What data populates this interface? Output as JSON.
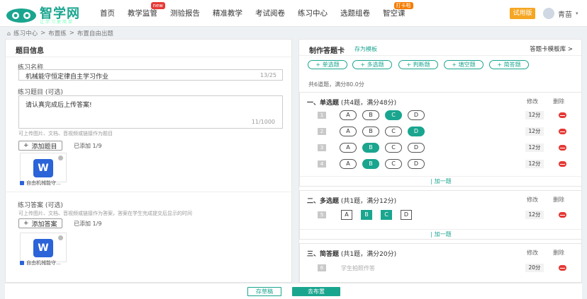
{
  "header": {
    "brand": "智学网",
    "brand_sub": "让学习更简单",
    "nav": [
      {
        "label": "首页",
        "badge": ""
      },
      {
        "label": "教学监管",
        "badge": "new"
      },
      {
        "label": "测验报告",
        "badge": ""
      },
      {
        "label": "精准教学",
        "badge": ""
      },
      {
        "label": "考试阅卷",
        "badge": ""
      },
      {
        "label": "练习中心",
        "badge": ""
      },
      {
        "label": "选题组卷",
        "badge": ""
      },
      {
        "label": "智空课",
        "badge": "打卡啦"
      }
    ],
    "trial_label": "试用版",
    "user_name": "青苗"
  },
  "breadcrumb": [
    "练习中心",
    "布置练",
    "布置自由出题"
  ],
  "left": {
    "title": "题目信息",
    "name_label": "练习名称",
    "name_value": "机械能守恒定律自主学习作业",
    "name_count": "13/25",
    "question_label": "练习题目 (可选)",
    "question_value": "请认真完成后上传答案!",
    "question_count": "11/1000",
    "upload_hint": "可上传图片、文档、音视频或链接作为题目",
    "add_question_label": "添加题目",
    "question_added": "已添加 1/9",
    "question_file": "自由机械能守...",
    "answer_label": "练习答案 (可选)",
    "answer_hint": "可上传图片、文档、音视频或链接作为答案，答案在学生完成提交后显示的时间",
    "add_answer_label": "添加答案",
    "answer_added": "已添加 1/9",
    "answer_file": "自由机械能守..."
  },
  "right": {
    "title": "制作答题卡",
    "save_template": "存为模板",
    "library_link": "答题卡模板库 >",
    "type_buttons": [
      "+ 单选题",
      "+ 多选题",
      "+ 判断题",
      "+ 填空题",
      "+ 简答题"
    ],
    "summary": "共6道题，满分80.0分",
    "col_edit": "修改",
    "col_delete": "删除",
    "add_one": "| 加一题",
    "sections": [
      {
        "title": "一、单选题",
        "meta": "(共4题，满分48分)",
        "rows": [
          {
            "num": "1",
            "options": [
              "A",
              "B",
              "C",
              "D"
            ],
            "selected": [
              "C"
            ],
            "score": "12分"
          },
          {
            "num": "2",
            "options": [
              "A",
              "B",
              "C",
              "D"
            ],
            "selected": [
              "D"
            ],
            "score": "12分"
          },
          {
            "num": "3",
            "options": [
              "A",
              "B",
              "C",
              "D"
            ],
            "selected": [
              "B"
            ],
            "score": "12分"
          },
          {
            "num": "4",
            "options": [
              "A",
              "B",
              "C",
              "D"
            ],
            "selected": [
              "B"
            ],
            "score": "12分"
          }
        ]
      },
      {
        "title": "二、多选题",
        "meta": "(共1题，满分12分)",
        "rows": [
          {
            "num": "5",
            "options": [
              "A",
              "B",
              "C",
              "D"
            ],
            "selected": [
              "B",
              "C"
            ],
            "score": "12分"
          }
        ]
      },
      {
        "title": "三、简答题",
        "meta": "(共1题，满分20分)",
        "rows": [
          {
            "num": "6",
            "placeholder": "学生拍照作答",
            "score": "20分"
          }
        ]
      }
    ]
  },
  "footer": {
    "draft_label": "存草稿",
    "publish_label": "去布置"
  },
  "colors": {
    "accent": "#1aa58f",
    "delete": "#e53935",
    "trial": "#f5a623",
    "word": "#2b63d8"
  }
}
